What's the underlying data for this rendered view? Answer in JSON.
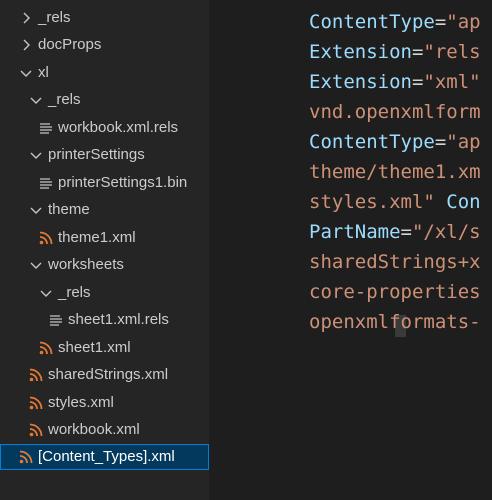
{
  "explorer": {
    "items": [
      {
        "label": "_rels"
      },
      {
        "label": "docProps"
      },
      {
        "label": "xl"
      },
      {
        "label": "_rels"
      },
      {
        "label": "workbook.xml.rels"
      },
      {
        "label": "printerSettings"
      },
      {
        "label": "printerSettings1.bin"
      },
      {
        "label": "theme"
      },
      {
        "label": "theme1.xml"
      },
      {
        "label": "worksheets"
      },
      {
        "label": "_rels"
      },
      {
        "label": "sheet1.xml.rels"
      },
      {
        "label": "sheet1.xml"
      },
      {
        "label": "sharedStrings.xml"
      },
      {
        "label": "styles.xml"
      },
      {
        "label": "workbook.xml"
      },
      {
        "label": "[Content_Types].xml"
      }
    ]
  },
  "editor": {
    "lines": [
      {
        "attr": "ContentType",
        "eq": "=",
        "str": "\"ap"
      },
      {
        "attr": "Extension",
        "eq": "=",
        "str": "\"rels"
      },
      {
        "attr": "Extension",
        "eq": "=",
        "str": "\"xml\""
      },
      {
        "attr": "",
        "eq": "",
        "str": "vnd.openxmlform"
      },
      {
        "attr": "ContentType",
        "eq": "=",
        "str": "\"ap"
      },
      {
        "attr": "",
        "eq": "",
        "str": "theme/theme1.xm"
      },
      {
        "attr": "",
        "eq": "",
        "str": "styles.xml\" ",
        "tail": "Con"
      },
      {
        "attr": "PartName",
        "eq": "=",
        "str": "\"/xl/s"
      },
      {
        "attr": "",
        "eq": "",
        "str": "sharedStrings+x"
      },
      {
        "attr": "",
        "eq": "",
        "str": "core-properties"
      },
      {
        "attr": "",
        "eq": "",
        "str": "openxmlformats-"
      }
    ]
  },
  "colors": {
    "sidebar_bg": "#252526",
    "editor_bg": "#1e1e1e",
    "selection_bg": "#04395e",
    "selection_border": "#007fd4",
    "xml_icon": "#e37933",
    "attr": "#9cdcfe",
    "string": "#ce9178"
  }
}
